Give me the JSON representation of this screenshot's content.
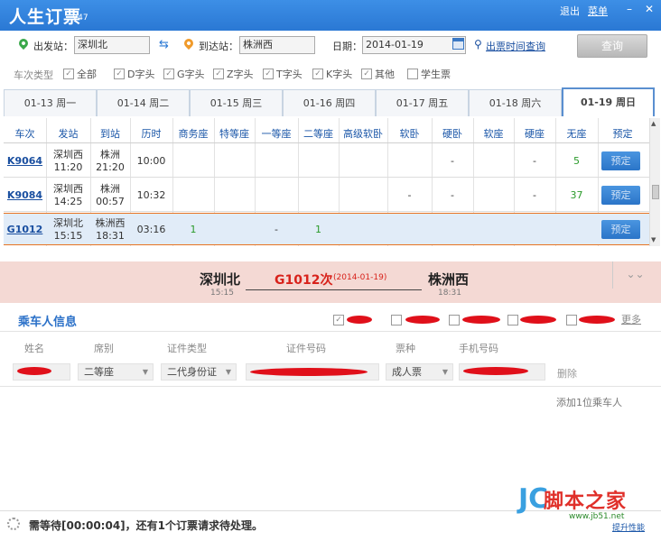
{
  "window": {
    "title": "人生订票",
    "version": "V47",
    "logout": "退出",
    "menu": "菜单",
    "controls": [
      "–",
      "✕"
    ]
  },
  "search": {
    "from_label": "出发站：",
    "from_value": "深圳北",
    "to_label": "到达站：",
    "to_value": "株洲西",
    "date_label": "日期：",
    "date_value": "2014-01-19",
    "time_query_link": "出票时间查询",
    "query_button": "查询"
  },
  "filters": {
    "label": "车次类型",
    "options": [
      {
        "label": "全部",
        "checked": true
      },
      {
        "label": "D字头",
        "checked": true
      },
      {
        "label": "G字头",
        "checked": true
      },
      {
        "label": "Z字头",
        "checked": true
      },
      {
        "label": "T字头",
        "checked": true
      },
      {
        "label": "K字头",
        "checked": true
      },
      {
        "label": "其他",
        "checked": true
      },
      {
        "label": "学生票",
        "checked": false
      }
    ]
  },
  "date_tabs": [
    "01-13 周一",
    "01-14 周二",
    "01-15 周三",
    "01-16 周四",
    "01-17 周五",
    "01-18 周六",
    "01-19 周日"
  ],
  "table": {
    "columns": [
      "车次",
      "发站",
      "到站",
      "历时",
      "商务座",
      "特等座",
      "一等座",
      "二等座",
      "高级软卧",
      "软卧",
      "硬卧",
      "软座",
      "硬座",
      "无座",
      "预定"
    ],
    "rows": [
      {
        "train": "K9064",
        "from": "深圳西",
        "dep": "11:20",
        "to": "株洲",
        "arr": "21:20",
        "dur": "10:00",
        "business": "",
        "special": "",
        "first": "",
        "second": "",
        "hsoft": "",
        "soft": "",
        "hard": "-",
        "softseat": "",
        "hardseat": "-",
        "noseat": "5",
        "book": "预定"
      },
      {
        "train": "K9084",
        "from": "深圳西",
        "dep": "14:25",
        "to": "株洲",
        "arr": "00:57",
        "dur": "10:32",
        "business": "",
        "special": "",
        "first": "",
        "second": "",
        "hsoft": "",
        "soft": "-",
        "hard": "-",
        "softseat": "",
        "hardseat": "-",
        "noseat": "37",
        "book": "预定"
      },
      {
        "train": "G1012",
        "from": "深圳北",
        "dep": "15:15",
        "to": "株洲西",
        "arr": "18:31",
        "dur": "03:16",
        "business": "1",
        "special": "",
        "first": "-",
        "second": "1",
        "hsoft": "",
        "soft": "",
        "hard": "",
        "softseat": "",
        "hardseat": "",
        "noseat": "",
        "book": "预定"
      }
    ]
  },
  "route": {
    "from": "深圳北",
    "from_time": "15:15",
    "train": "G1012次",
    "date": "(2014-01-19)",
    "to": "株洲西",
    "to_time": "18:31",
    "collapse": "⌄⌄"
  },
  "passengers": {
    "title": "乘车人信息",
    "more": "更多",
    "columns": [
      "姓名",
      "席别",
      "证件类型",
      "证件号码",
      "票种",
      "手机号码"
    ],
    "row": {
      "seat": "二等座",
      "id_type": "二代身份证",
      "ticket_type": "成人票",
      "delete": "删除"
    },
    "add": "添加1位乘车人"
  },
  "status": {
    "message": "需等待[00:00:04]，还有1个订票请求待处理。"
  },
  "watermark": {
    "text": "脚本之家",
    "url": "www.jb51.net",
    "link": "提升性能"
  },
  "colors": {
    "titlebar": "#2a78d4",
    "accent_red": "#d8221b",
    "link_blue": "#1a4fa0"
  }
}
